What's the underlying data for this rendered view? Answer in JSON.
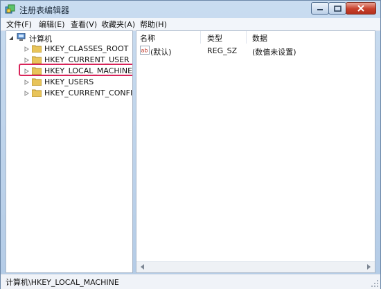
{
  "window": {
    "title": "注册表编辑器"
  },
  "menu": [
    "文件(F)",
    "编辑(E)",
    "查看(V)",
    "收藏夹(A)",
    "帮助(H)"
  ],
  "tree": {
    "root": "计算机",
    "items": [
      "HKEY_CLASSES_ROOT",
      "HKEY_CURRENT_USER",
      "HKEY_LOCAL_MACHINE",
      "HKEY_USERS",
      "HKEY_CURRENT_CONFIG"
    ],
    "selected": "HKEY_LOCAL_MACHINE"
  },
  "values": {
    "headers": [
      "名称",
      "类型",
      "数据"
    ],
    "rows": [
      {
        "name": "(默认)",
        "type": "REG_SZ",
        "data": "(数值未设置)",
        "icon": "ab-string-icon"
      }
    ]
  },
  "status": {
    "path": "计算机\\HKEY_LOCAL_MACHINE"
  },
  "colors": {
    "highlight": "#d8245a",
    "title_bg": "#c9dcf0"
  }
}
